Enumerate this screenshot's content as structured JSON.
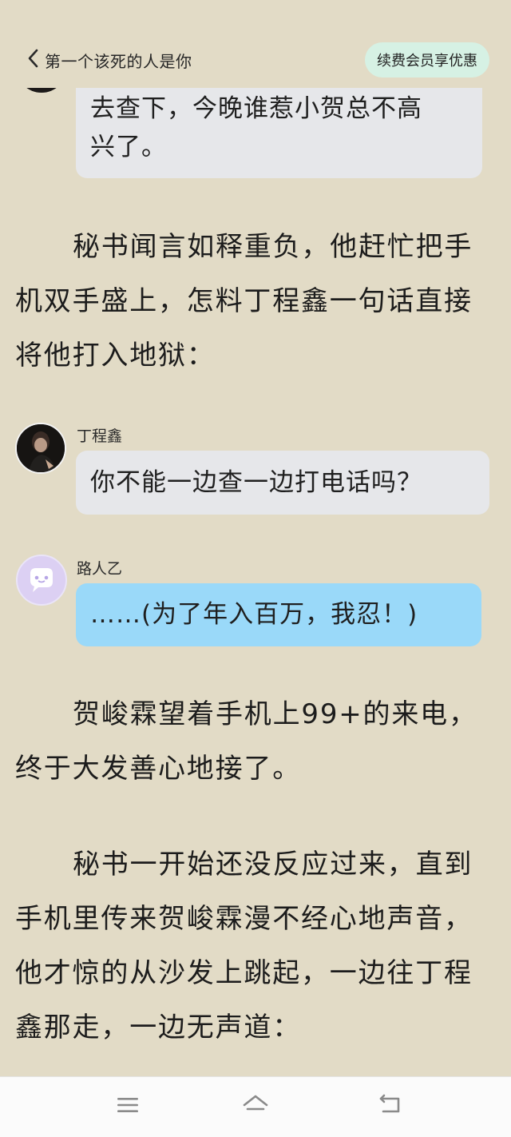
{
  "header": {
    "back_label": "第一个该死的人是你",
    "vip_label": "续费会员享优惠"
  },
  "messages": [
    {
      "speaker": "",
      "lines": [
        "去查下，今晚谁惹小贺总不高",
        "兴了。"
      ],
      "color": "#e6e7ea"
    },
    {
      "speaker": "丁程鑫",
      "lines": [
        "你不能一边查一边打电话吗？"
      ],
      "color": "#e6e7ea"
    },
    {
      "speaker": "路人乙",
      "lines": [
        "……(为了年入百万，我忍！)"
      ],
      "color": "#9ad9f9"
    }
  ],
  "paragraphs": [
    "秘书闻言如释重负，他赶忙把手机双手盛上，怎料丁程鑫一句话直接将他打入地狱：",
    "贺峻霖望着手机上99+的来电，终于大发善心地接了。",
    "秘书一开始还没反应过来，直到手机里传来贺峻霖漫不经心地声音，他才惊的从沙发上跳起，一边往丁程鑫那走，一边无声道："
  ],
  "navbar": {
    "icons": [
      "menu-icon",
      "home-icon",
      "back-icon"
    ]
  },
  "colors": {
    "page_background": "#e2dbc6",
    "vip_button": "#d6f1e4",
    "grey_bubble": "#e6e7ea",
    "blue_bubble": "#9ad9f9"
  }
}
